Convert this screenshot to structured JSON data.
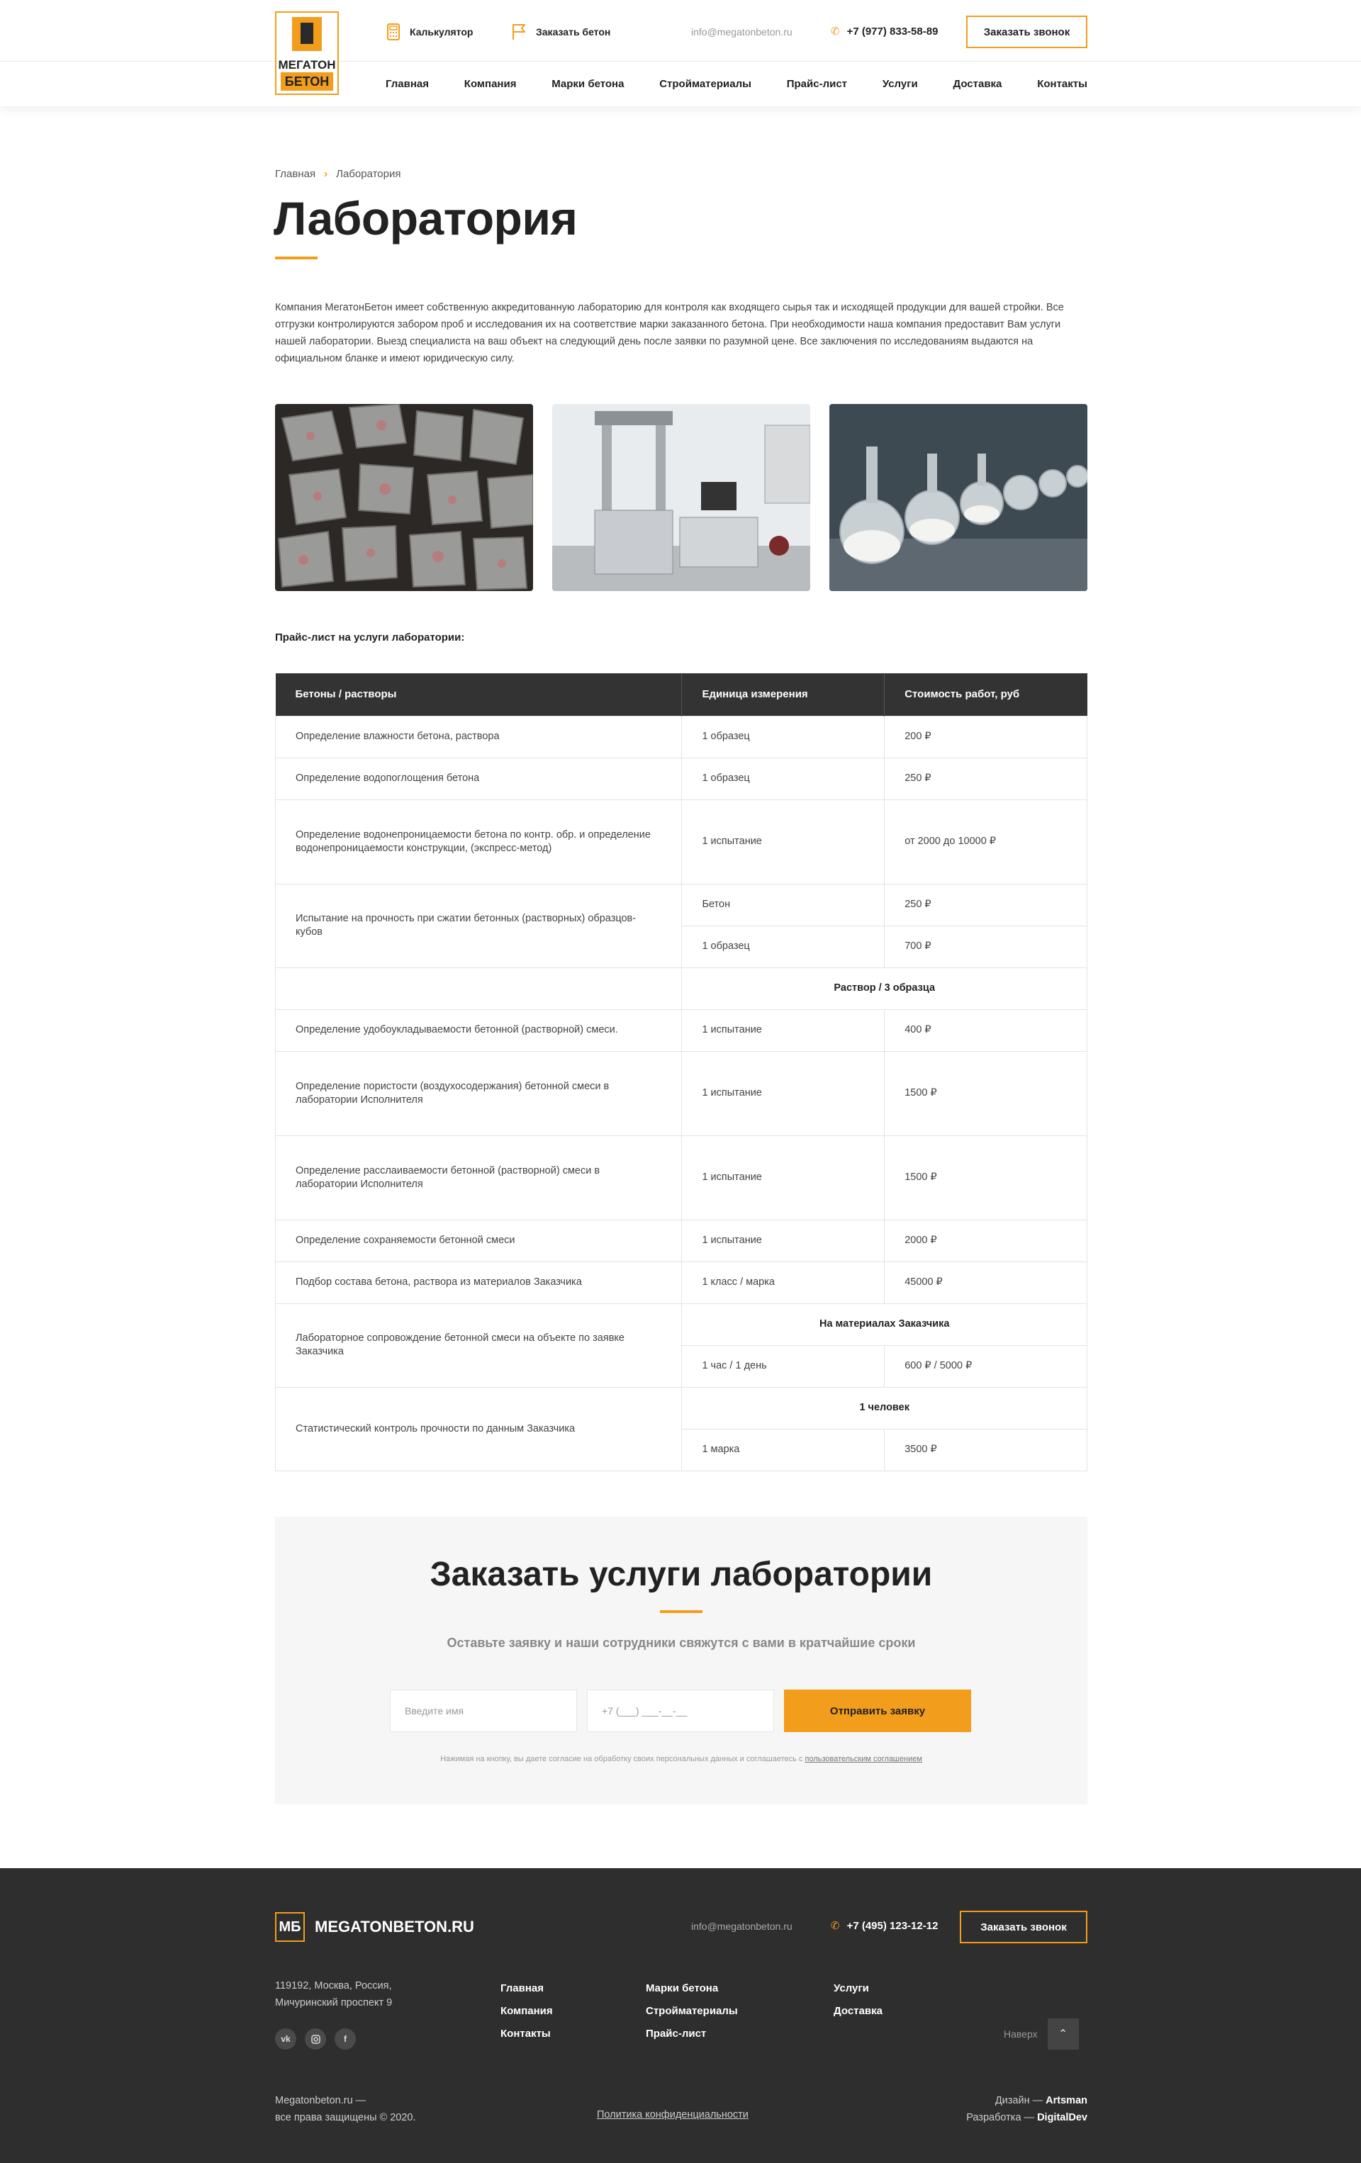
{
  "header": {
    "logo_line1": "МЕГАТОН",
    "logo_line2": "БЕТОН",
    "calculator_label": "Калькулятор",
    "order_concrete_label": "Заказать бетон",
    "email": "info@megatonbeton.ru",
    "phone": "+7 (977) 833-58-89",
    "callback_label": "Заказать звонок",
    "nav": [
      "Главная",
      "Компания",
      "Марки бетона",
      "Стройматериалы",
      "Прайс-лист",
      "Услуги",
      "Доставка",
      "Контакты"
    ]
  },
  "breadcrumb": {
    "home": "Главная",
    "current": "Лаборатория"
  },
  "page": {
    "title": "Лаборатория",
    "intro": "Компания МегатонБетон имеет собственную аккредитованную лабораторию для контроля как входящего сырья так и исходящей продукции для вашей стройки. Все отгрузки контролируются забором проб и исследования их на соответствие марки заказанного бетона. При необходимости наша компания предоставит Вам услуги нашей лаборатории. Выезд специалиста на ваш объект на следующий день после заявки по разумной цене. Все заключения по исследованиям выдаются на официальном бланке и имеют юридическую силу.",
    "price_caption": "Прайс-лист на услуги лаборатории:"
  },
  "table": {
    "headers": [
      "Бетоны / растворы",
      "Единица измерения",
      "Стоимость работ, руб"
    ],
    "r1": [
      "Определение влажности бетона, раствора",
      "1 образец",
      "200 ₽"
    ],
    "r2": [
      "Определение водопоглощения бетона",
      "1 образец",
      "250 ₽"
    ],
    "r3": [
      "Определение водонепроницаемости бетона по контр. обр. и определение водонепроницаемости конструкции, (экспресс-метод)",
      "1 испытание",
      "от 2000 до 10000 ₽"
    ],
    "r4": [
      "Испытание на прочность при сжатии бетонных (растворных) образцов-кубов",
      "Бетон",
      "250 ₽",
      "1 образец",
      "700 ₽"
    ],
    "r5_subheader": "Раствор / 3 образца",
    "r6": [
      "Определение удобоукладываемости бетонной (растворной) смеси.",
      "1 испытание",
      "400 ₽"
    ],
    "r7": [
      "Определение пористости (воздухосодержания) бетонной смеси в лаборатории Исполнителя",
      "1 испытание",
      "1500 ₽"
    ],
    "r8": [
      "Определение расслаиваемости бетонной (растворной) смеси в лаборатории Исполнителя",
      "1 испытание",
      "1500 ₽"
    ],
    "r9": [
      "Определение сохраняемости бетонной смеси",
      "1 испытание",
      "2000 ₽"
    ],
    "r10": [
      "Подбор состава бетона, раствора из материалов Заказчика",
      "1 класс / марка",
      "45000 ₽"
    ],
    "r11": [
      "Лабораторное сопровождение бетонной смеси на объекте по заявке Заказчика",
      "На материалах Заказчика",
      "1 час / 1 день",
      "600 ₽ / 5000 ₽"
    ],
    "r12": [
      "Статистический контроль прочности по данным Заказчика",
      "1 человек",
      "1 марка",
      "3500 ₽"
    ]
  },
  "order": {
    "title": "Заказать услуги лаборатории",
    "subtitle": "Оставьте заявку и наши сотрудники свяжутся с вами в кратчайшие сроки",
    "name_placeholder": "Введите имя",
    "phone_placeholder": "+7 (___) ___-__-__",
    "submit_label": "Отправить заявку",
    "consent_text": "Нажимая на кнопку, вы даете согласие на обработку своих персональных данных и соглашаетесь с",
    "consent_link": "пользовательским соглашением"
  },
  "footer": {
    "logo_mark": "МБ",
    "logo_text": "MEGATONBETON.RU",
    "email": "info@megatonbeton.ru",
    "phone": "+7 (495) 123-12-12",
    "callback_label": "Заказать звонок",
    "address_line1": "119192, Москва, Россия,",
    "address_line2": "Мичуринский проспект 9",
    "col1": [
      "Главная",
      "Компания",
      "Контакты"
    ],
    "col2": [
      "Марки бетона",
      "Стройматериалы",
      "Прайс-лист"
    ],
    "col3": [
      "Услуги",
      "Доставка"
    ],
    "to_top_label": "Наверх",
    "copy_line1": "Megatonbeton.ru —",
    "copy_line2": "все права защищены © 2020.",
    "policy_label": "Политика конфиденциальности",
    "design_prefix": "Дизайн —",
    "design_name": "Artsman",
    "dev_prefix": "Разработка —",
    "dev_name": "DigitalDev"
  },
  "colors": {
    "accent": "#f29d1c",
    "dark": "#2e2e2e",
    "table_header": "#333333"
  }
}
